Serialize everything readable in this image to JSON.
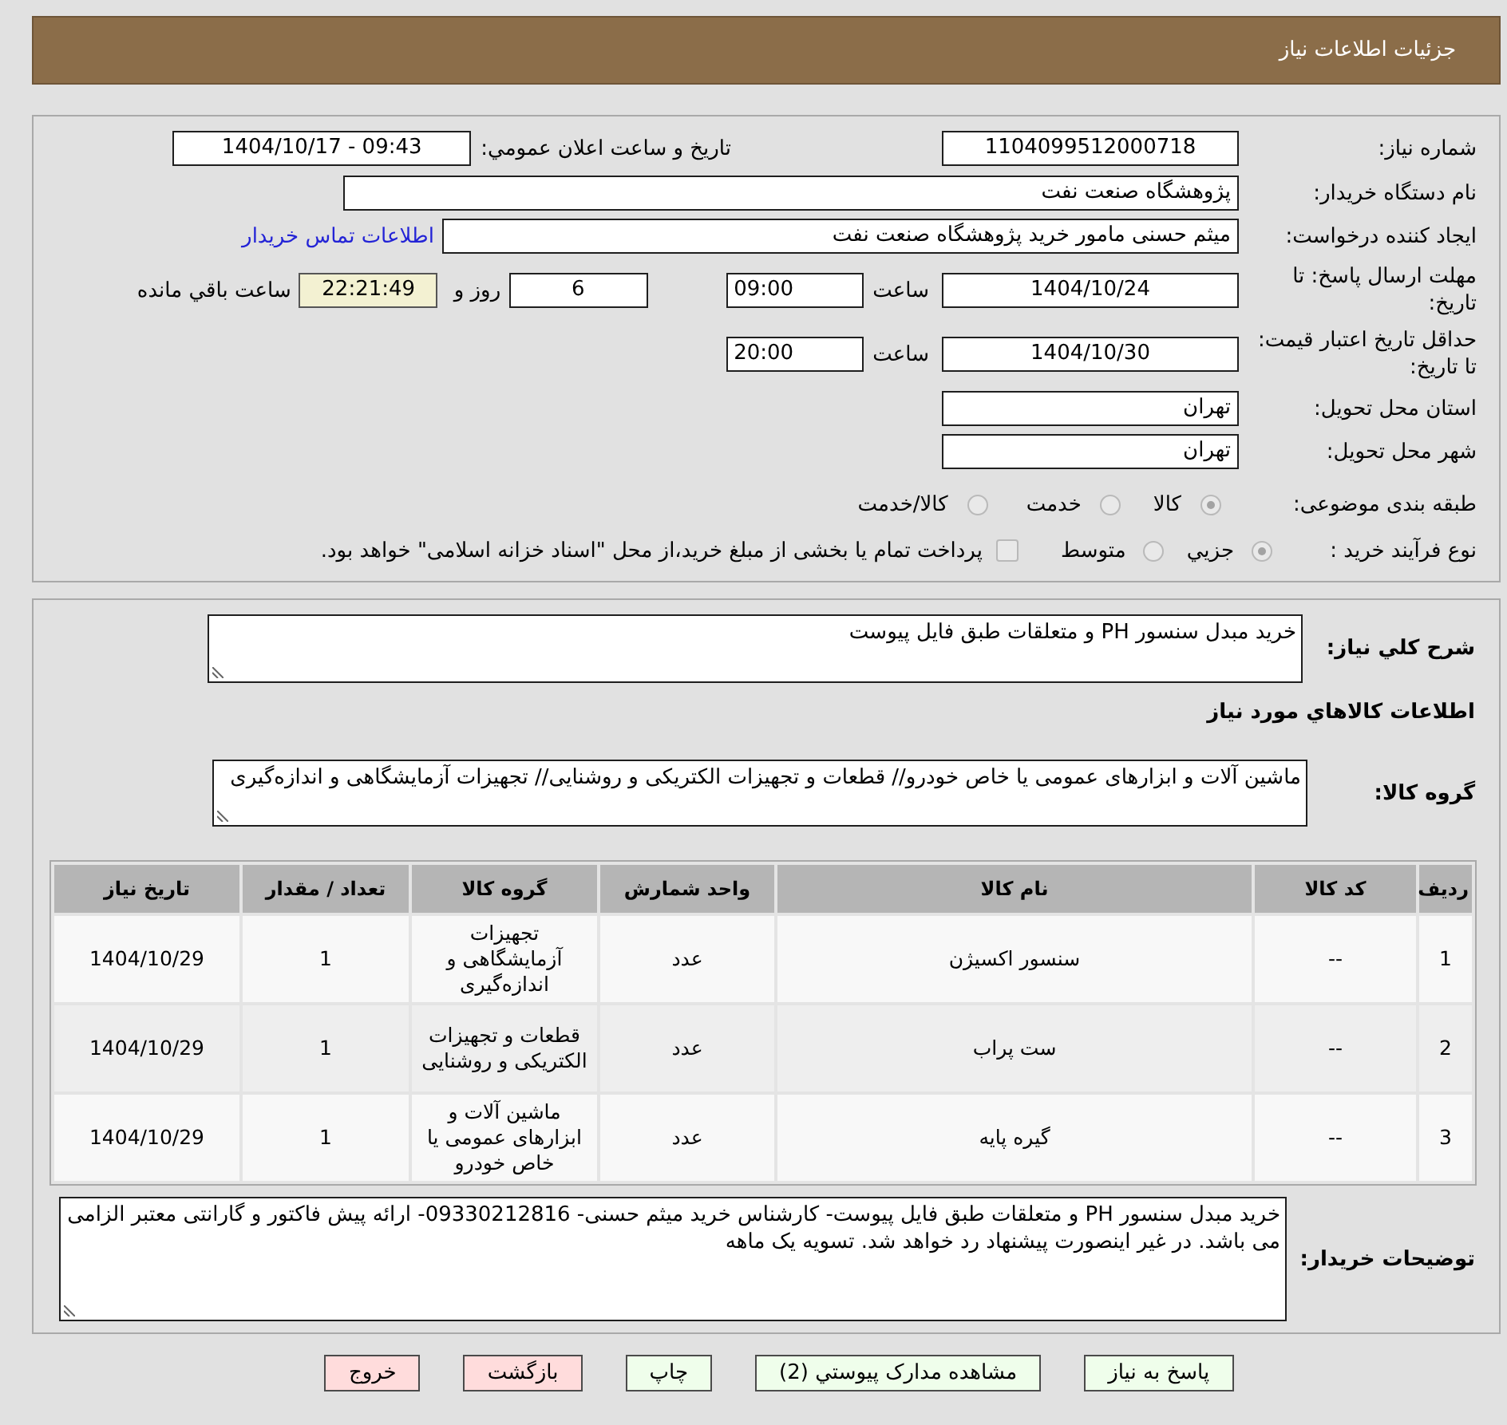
{
  "header": {
    "title": "جزئیات اطلاعات نیاز"
  },
  "need_info": {
    "need_number": {
      "label": "شماره نیاز:",
      "value": "1104099512000718"
    },
    "announce": {
      "label": "تاریخ و ساعت اعلان عمومي:",
      "value": "1404/10/17 - 09:43"
    },
    "buyer_org": {
      "label": "نام دستگاه خریدار:",
      "value": "پژوهشگاه صنعت نفت"
    },
    "requester": {
      "label": "ایجاد کننده درخواست:",
      "value": "میثم حسنی مامور خرید پژوهشگاه صنعت نفت",
      "link": "اطلاعات تماس خریدار"
    },
    "reply_deadline": {
      "label": "مهلت ارسال پاسخ: تا تاریخ:",
      "date": "1404/10/24",
      "time_label": "ساعت",
      "time": "09:00",
      "days": "6",
      "days_label": "روز و",
      "remaining": "22:21:49",
      "remaining_label": "ساعت باقي مانده"
    },
    "price_validity": {
      "label": "حداقل تاریخ اعتبار قیمت: تا تاریخ:",
      "date": "1404/10/30",
      "time_label": "ساعت",
      "time": "20:00"
    },
    "province": {
      "label": "استان محل تحویل:",
      "value": "تهران"
    },
    "city": {
      "label": "شهر محل تحویل:",
      "value": "تهران"
    },
    "category": {
      "label": "طبقه بندی موضوعی:",
      "options": [
        {
          "label": "کالا",
          "selected": true,
          "disabled": true
        },
        {
          "label": "خدمت",
          "selected": false,
          "disabled": true
        },
        {
          "label": "کالا/خدمت",
          "selected": false,
          "disabled": true
        }
      ]
    },
    "process": {
      "label": "نوع فرآیند خرید :",
      "options": [
        {
          "label": "جزيي",
          "selected": true,
          "disabled": true
        },
        {
          "label": "متوسط",
          "selected": false,
          "disabled": true
        }
      ],
      "treasury": {
        "label": "پرداخت تمام یا بخشی از مبلغ خرید،از محل \"اسناد خزانه اسلامی\" خواهد بود.",
        "checked": false,
        "disabled": true
      }
    }
  },
  "details": {
    "summary": {
      "label": "شرح كلي نیاز:",
      "value": "خرید مبدل سنسور PH و متعلقات طبق فایل پیوست"
    },
    "goods_heading": "اطلاعات کالاهاي مورد نیاز",
    "goods_group": {
      "label": "گروه کالا:",
      "value": "ماشین آلات و ابزارهای عمومی یا خاص خودرو// قطعات و تجهیزات الکتریکی و روشنایی// تجهیزات آزمایشگاهی و اندازه‌گیری"
    },
    "table": {
      "columns": [
        "ردیف",
        "کد کالا",
        "نام کالا",
        "واحد شمارش",
        "گروه کالا",
        "تعداد / مقدار",
        "تاریخ نیاز"
      ],
      "rows": [
        [
          "1",
          "--",
          "سنسور اکسیژن",
          "عدد",
          "تجهیزات آزمایشگاهی و اندازه‌گیری",
          "1",
          "1404/10/29"
        ],
        [
          "2",
          "--",
          "ست پراب",
          "عدد",
          "قطعات و تجهیزات الکتریکی و روشنایی",
          "1",
          "1404/10/29"
        ],
        [
          "3",
          "--",
          "گیره پایه",
          "عدد",
          "ماشین آلات و ابزارهای عمومی یا خاص خودرو",
          "1",
          "1404/10/29"
        ]
      ]
    },
    "buyer_notes": {
      "label": "توضیحات خریدار:",
      "value": "خرید مبدل سنسور PH و متعلقات طبق فایل پیوست- کارشناس خرید میثم حسنی- 09330212816- ارائه پیش فاکتور و گارانتی معتبر الزامی می باشد. در غیر اینصورت پیشنهاد رد خواهد شد. تسویه یک ماهه"
    }
  },
  "buttons": [
    {
      "label": "پاسخ به نیاز",
      "kind": "action"
    },
    {
      "label": "مشاهده مدارک پیوستي (2)",
      "kind": "action"
    },
    {
      "label": "چاپ",
      "kind": "action"
    },
    {
      "label": "بازگشت",
      "kind": "exit"
    },
    {
      "label": "خروج",
      "kind": "exit"
    }
  ]
}
